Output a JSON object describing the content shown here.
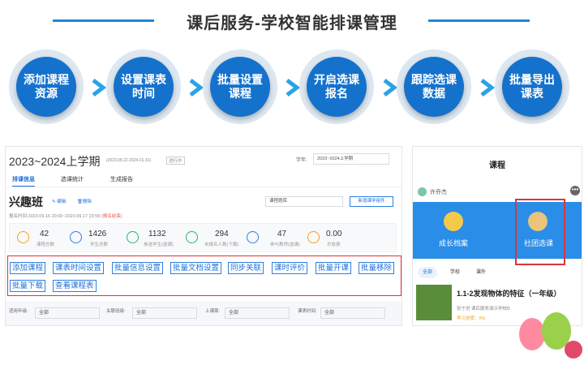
{
  "header": {
    "title": "课后服务-学校智能排课管理"
  },
  "steps": [
    {
      "label": "添加课程\n资源"
    },
    {
      "label": "设置课表\n时间"
    },
    {
      "label": "批量设置\n课程"
    },
    {
      "label": "开启选课\n报名"
    },
    {
      "label": "跟踪选课\n数据"
    },
    {
      "label": "批量导出\n课表"
    }
  ],
  "colors": {
    "accent": "#1572cc",
    "highlight": "#d9363e",
    "secondary": "#1e88d8"
  },
  "left": {
    "term_title": "2023~2024上学期",
    "term_range": "(2023.08.22-2024.01.31)",
    "term_status": "进行中",
    "semester_label": "学年:",
    "semester_value": "2023~2024上学期",
    "tabs": [
      "排课信息",
      "选课统计",
      "生成报告"
    ],
    "class_name": "兴趣班",
    "edit_label": "编辑",
    "delete_label": "删除",
    "course_select": "课程题库",
    "new_course_group_btn": "新增课学组件",
    "signup_prefix": "报名时间:",
    "signup_time": "2023.09.16 20:00~2023.09.17 23:59",
    "signup_status": "(报名结束)",
    "stats": [
      {
        "value": "42",
        "label": "课程总数",
        "icon": "book-icon",
        "color": "#f0a21c"
      },
      {
        "value": "1426",
        "label": "学生总数",
        "icon": "student-icon",
        "color": "#2f7fe0"
      },
      {
        "value": "1132",
        "label": "参选学生(选课)",
        "icon": "check-user-icon",
        "color": "#2bb36b"
      },
      {
        "value": "294",
        "label": "未报名人数(下载)",
        "icon": "user-icon",
        "color": "#2bb36b"
      },
      {
        "value": "47",
        "label": "参与教师(选课)",
        "icon": "teacher-icon",
        "color": "#2f7fe0"
      },
      {
        "value": "0.00",
        "label": "总收费",
        "icon": "money-icon",
        "color": "#f0a21c"
      }
    ],
    "actions_row1": [
      "添加课程",
      "课表时间设置",
      "批量信息设置",
      "批量文档设置",
      "同步关联",
      "课时评价",
      "批量开课",
      "批量移除"
    ],
    "actions_row2": [
      "批量下载",
      "查看课程表"
    ],
    "filters": [
      {
        "label": "适用年级:",
        "value": "全部"
      },
      {
        "label": "关联班级:",
        "value": "全部"
      },
      {
        "label": "上课周:",
        "value": "全部"
      },
      {
        "label": "课表时间:",
        "value": "全部"
      }
    ]
  },
  "right": {
    "title": "课程",
    "user_name": "许乔杰",
    "tiles": [
      {
        "label": "成长档案",
        "icon": "growth-file-icon"
      },
      {
        "label": "社团选课",
        "icon": "club-course-icon"
      }
    ],
    "filter_tabs": [
      "全部",
      "学校",
      "课外"
    ],
    "course_title": "1.1-2发现物体的特征（一年级）",
    "course_meta": "张宁进  课后服务演示学校B",
    "course_sub": "学习进度：0%"
  }
}
